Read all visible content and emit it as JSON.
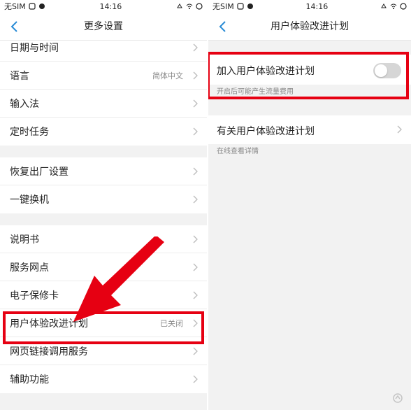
{
  "status_bar": {
    "carrier": "无SIM",
    "time": "14:16"
  },
  "left_screen": {
    "title": "更多设置",
    "groups": [
      [
        {
          "label": "日期与时间",
          "value": ""
        },
        {
          "label": "语言",
          "value": "简体中文"
        },
        {
          "label": "输入法",
          "value": ""
        },
        {
          "label": "定时任务",
          "value": ""
        }
      ],
      [
        {
          "label": "恢复出厂设置",
          "value": ""
        },
        {
          "label": "一键换机",
          "value": ""
        }
      ],
      [
        {
          "label": "说明书",
          "value": ""
        },
        {
          "label": "服务网点",
          "value": ""
        },
        {
          "label": "电子保修卡",
          "value": ""
        },
        {
          "label": "用户体验改进计划",
          "value": "已关闭"
        },
        {
          "label": "网页链接调用服务",
          "value": ""
        },
        {
          "label": "辅助功能",
          "value": ""
        }
      ]
    ]
  },
  "right_screen": {
    "title": "用户体验改进计划",
    "join_label": "加入用户体验改进计划",
    "join_enabled": false,
    "join_note": "开启后可能产生流量费用",
    "about_label": "有关用户体验改进计划",
    "about_note": "在线查看详情"
  },
  "colors": {
    "highlight": "#e60012",
    "background": "#f2f2f2"
  }
}
